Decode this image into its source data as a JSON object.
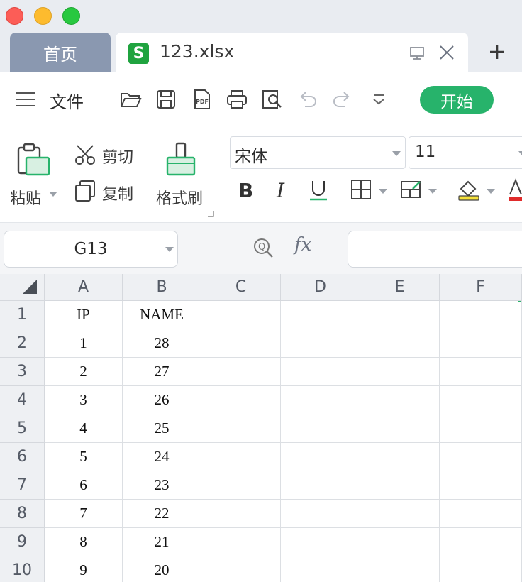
{
  "tabs": {
    "home": "首页",
    "file": "123.xlsx"
  },
  "menu": {
    "file": "文件",
    "start": "开始"
  },
  "ribbon": {
    "paste": "粘贴",
    "cut": "剪切",
    "copy": "复制",
    "format_painter": "格式刷",
    "font_name": "宋体",
    "font_size": "11"
  },
  "formula_bar": {
    "cell_ref": "G13",
    "fx": "fx",
    "value": ""
  },
  "sheet": {
    "columns": [
      "A",
      "B",
      "C",
      "D",
      "E",
      "F"
    ],
    "rows": [
      {
        "num": "1",
        "cells": [
          "IP",
          "NAME",
          "",
          "",
          "",
          ""
        ]
      },
      {
        "num": "2",
        "cells": [
          "1",
          "28",
          "",
          "",
          "",
          ""
        ]
      },
      {
        "num": "3",
        "cells": [
          "2",
          "27",
          "",
          "",
          "",
          ""
        ]
      },
      {
        "num": "4",
        "cells": [
          "3",
          "26",
          "",
          "",
          "",
          ""
        ]
      },
      {
        "num": "5",
        "cells": [
          "4",
          "25",
          "",
          "",
          "",
          ""
        ]
      },
      {
        "num": "6",
        "cells": [
          "5",
          "24",
          "",
          "",
          "",
          ""
        ]
      },
      {
        "num": "7",
        "cells": [
          "6",
          "23",
          "",
          "",
          "",
          ""
        ]
      },
      {
        "num": "8",
        "cells": [
          "7",
          "22",
          "",
          "",
          "",
          ""
        ]
      },
      {
        "num": "9",
        "cells": [
          "8",
          "21",
          "",
          "",
          "",
          ""
        ]
      },
      {
        "num": "10",
        "cells": [
          "9",
          "20",
          "",
          "",
          "",
          ""
        ]
      }
    ]
  },
  "colors": {
    "accent": "#27b36b",
    "tab_home": "#8a98b0",
    "file_icon": "#1fa33f"
  }
}
